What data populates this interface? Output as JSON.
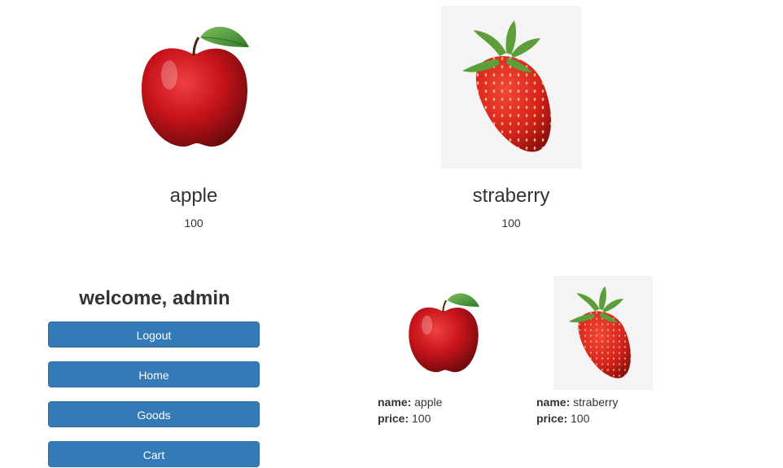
{
  "products": [
    {
      "name": "apple",
      "price": "100",
      "image_icon": "apple-image"
    },
    {
      "name": "straberry",
      "price": "100",
      "image_icon": "strawberry-image"
    }
  ],
  "sidebar": {
    "welcome": "welcome, admin",
    "buttons": {
      "logout": "Logout",
      "home": "Home",
      "goods": "Goods",
      "cart": "Cart"
    }
  },
  "cart": {
    "name_label": "name:",
    "price_label": "price:",
    "items": [
      {
        "name": "apple",
        "price": "100"
      },
      {
        "name": "straberry",
        "price": "100"
      }
    ]
  },
  "colors": {
    "button_primary": "#337ab7",
    "text": "#333333",
    "apple_red": "#c4161c",
    "leaf_green": "#4e9a3a"
  }
}
